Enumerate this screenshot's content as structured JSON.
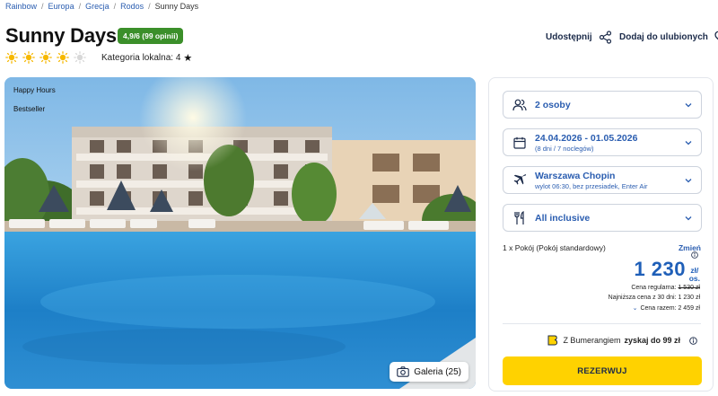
{
  "breadcrumb": {
    "items": [
      "Rainbow",
      "Europa",
      "Grecja",
      "Rodos"
    ],
    "current": "Sunny Days"
  },
  "hotel": {
    "name": "Sunny Days",
    "rating": "4,9/6 (99 opinii)",
    "suns_total": 5,
    "suns_filled": 4,
    "local_category": "Kategoria lokalna: 4"
  },
  "actions": {
    "share": "Udostępnij",
    "favorite": "Dodaj do ulubionych"
  },
  "gallery": {
    "tags": [
      "Happy Hours",
      "Bestseller"
    ],
    "button": "Galeria (25)"
  },
  "booking": {
    "people": "2 osoby",
    "dates": "24.04.2026 - 01.05.2026",
    "dates_sub": "(8 dni / 7 noclegów)",
    "airport": "Warszawa Chopin",
    "airport_sub": "wylot 06:30, bez przesiadek, Enter Air",
    "board": "All inclusive",
    "room": "1 x Pokój  (Pokój standardowy)",
    "change": "Zmień",
    "price": "1 230",
    "price_unit_1": "zł/",
    "price_unit_2": "os.",
    "regular_label": "Cena regularna:",
    "regular_price": "1 530 zł",
    "lowest": "Najniższa cena z 30 dni: 1 230 zł",
    "total": "Cena razem: 2 459 zł",
    "bumerang_prefix": "Z Bumerangiem",
    "bumerang_bold": "zyskaj do 99 zł",
    "reserve": "REZERWUJ"
  },
  "colors": {
    "accent_blue": "#2a5db0",
    "badge_green": "#3b8f2a",
    "reserve_yellow": "#ffd200",
    "sun_yellow": "#f6b800"
  }
}
